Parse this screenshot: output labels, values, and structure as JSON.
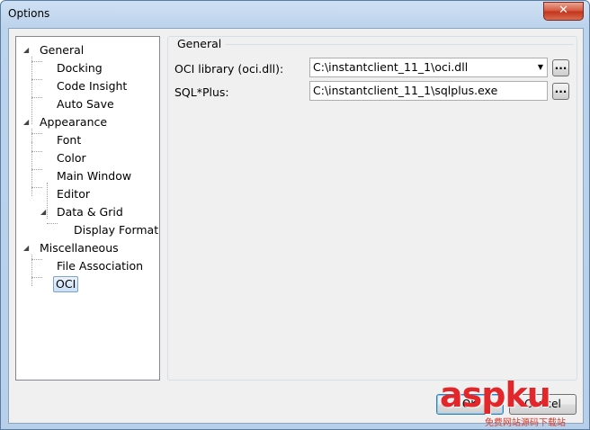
{
  "window": {
    "title": "Options",
    "close_glyph": "✕"
  },
  "tree": {
    "items": [
      {
        "label": "General",
        "expander": "◢"
      },
      {
        "label": "Docking"
      },
      {
        "label": "Code Insight"
      },
      {
        "label": "Auto Save"
      },
      {
        "label": "Appearance",
        "expander": "◢"
      },
      {
        "label": "Font"
      },
      {
        "label": "Color"
      },
      {
        "label": "Main Window"
      },
      {
        "label": "Editor"
      },
      {
        "label": "Data & Grid",
        "expander": "◢"
      },
      {
        "label": "Display Format"
      },
      {
        "label": "Miscellaneous",
        "expander": "◢"
      },
      {
        "label": "File Association"
      },
      {
        "label": "OCI",
        "selected": true
      }
    ]
  },
  "panel": {
    "group_title": "General",
    "oci_label": "OCI library (oci.dll):",
    "oci_value": "C:\\instantclient_11_1\\oci.dll",
    "sqlplus_label": "SQL*Plus:",
    "sqlplus_value": "C:\\instantclient_11_1\\sqlplus.exe",
    "browse_label": "...",
    "dropdown_glyph": "▼"
  },
  "footer": {
    "ok_label": "OK",
    "cancel_label": "Cancel"
  },
  "watermark": {
    "text": "aspku",
    "sub": "免费网站源码下载站",
    "color": "#e3262a"
  }
}
